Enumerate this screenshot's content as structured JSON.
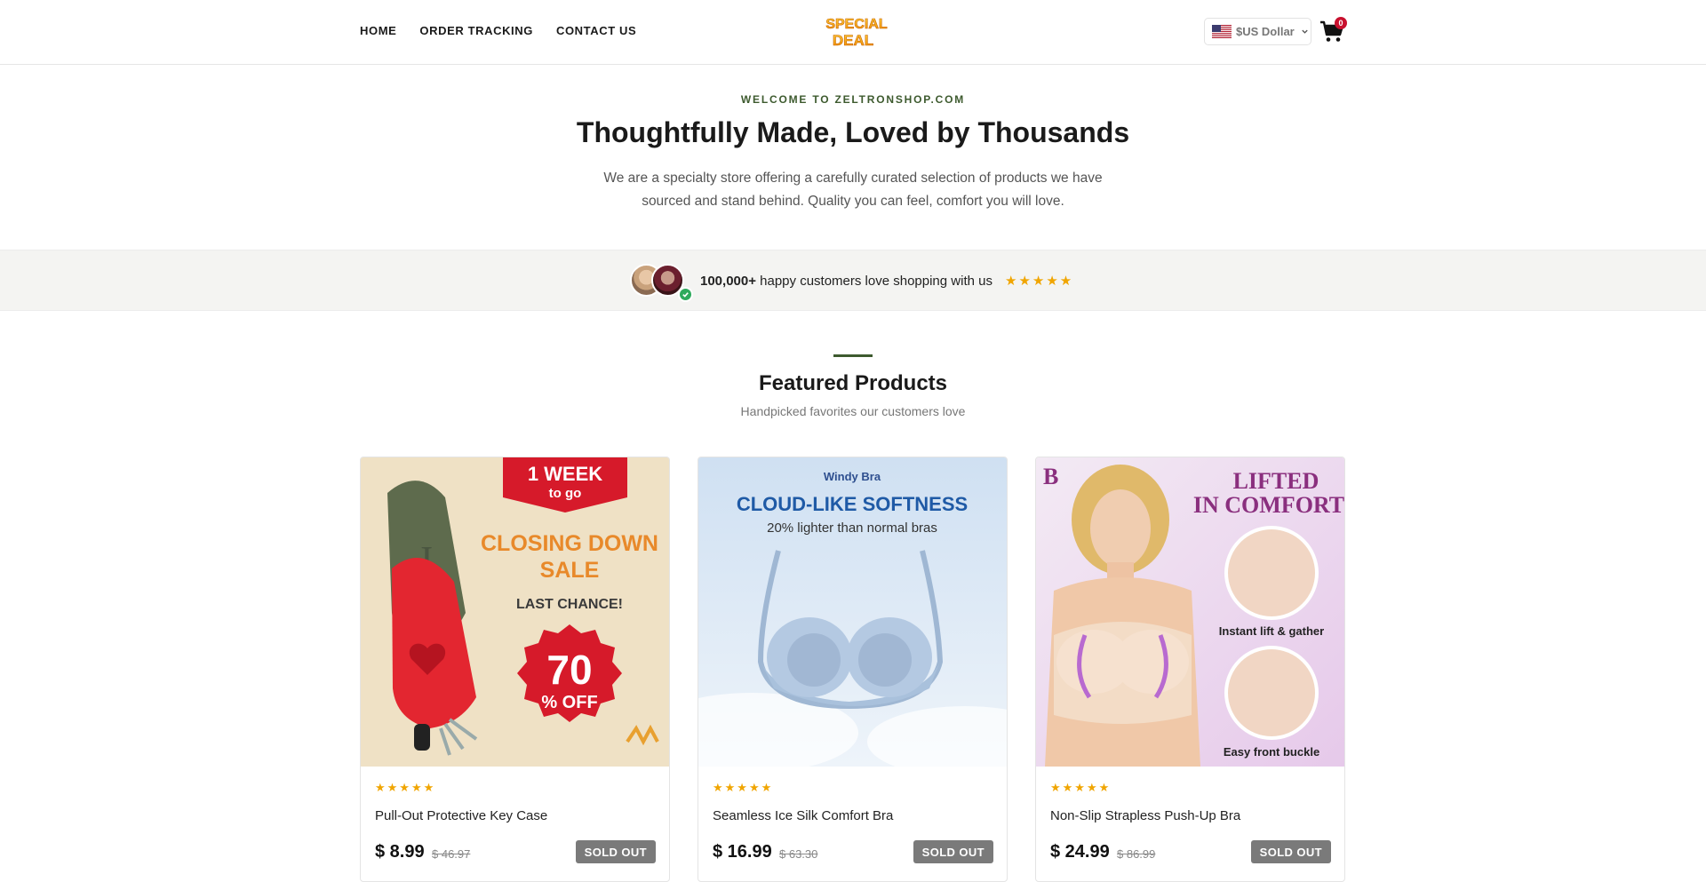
{
  "header": {
    "nav": [
      {
        "label": "HOME"
      },
      {
        "label": "ORDER TRACKING"
      },
      {
        "label": "CONTACT US"
      }
    ],
    "logo_text_line1": "SPECIAL",
    "logo_text_line2": "DEAL",
    "currency": {
      "label": "$US Dollar",
      "flag": "us-flag-icon"
    },
    "cart": {
      "count": "0",
      "icon": "cart-icon"
    }
  },
  "hero": {
    "eyebrow": "WELCOME TO ZELTRONSHOP.COM",
    "title": "Thoughtfully Made, Loved by Thousands",
    "description": "We are a specialty store offering a carefully curated selection of products we have sourced and stand behind. Quality you can feel, comfort you will love."
  },
  "social_proof": {
    "count": "100,000+",
    "text": " happy customers love shopping with us",
    "rating": "★★★★★"
  },
  "featured": {
    "title": "Featured Products",
    "subtitle": "Handpicked favorites our customers love",
    "products": [
      {
        "name": "Pull-Out Protective Key Case",
        "rating": "★★★★★",
        "price": "$ 8.99",
        "old_price": "$ 46.97",
        "status": "SOLD OUT",
        "image_text": {
          "badge_line1": "1 WEEK",
          "badge_line2": "to go",
          "headline_line1": "CLOSING DOWN",
          "headline_line2": "SALE",
          "sub": "LAST CHANCE!",
          "discount": "70",
          "discount_suffix": "% OFF",
          "monogram": "J"
        }
      },
      {
        "name": "Seamless Ice Silk Comfort Bra",
        "rating": "★★★★★",
        "price": "$ 16.99",
        "old_price": "$ 63.30",
        "status": "SOLD OUT",
        "image_text": {
          "brand": "Windy Bra",
          "headline": "CLOUD-LIKE SOFTNESS",
          "sub": "20% lighter than normal bras"
        }
      },
      {
        "name": "Non-Slip Strapless Push-Up Bra",
        "rating": "★★★★★",
        "price": "$ 24.99",
        "old_price": "$ 86.99",
        "status": "SOLD OUT",
        "image_text": {
          "brand": "B",
          "headline_line1": "LIFTED",
          "headline_line2": "IN COMFORT",
          "caption1": "Instant lift & gather",
          "caption2": "Easy front buckle"
        }
      }
    ]
  },
  "colors": {
    "accent_green": "#3d5a2e",
    "star": "#f0a500",
    "badge_red": "#c8102e",
    "sold_out": "#7a7a7a"
  }
}
